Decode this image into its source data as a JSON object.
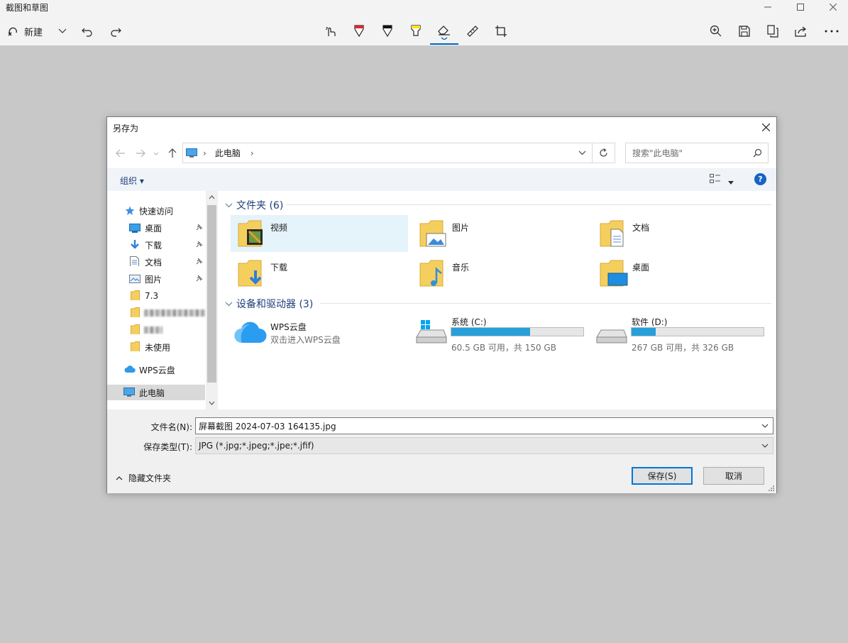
{
  "app": {
    "title": "截图和草图",
    "new_label": "新建"
  },
  "dialog": {
    "title": "另存为",
    "breadcrumb": [
      "此电脑"
    ],
    "search_placeholder": "搜索\"此电脑\"",
    "organize_label": "组织 ▾",
    "help_label": "?",
    "nav": {
      "quick_access": "快速访问",
      "items": [
        {
          "label": "桌面",
          "pinned": true
        },
        {
          "label": "下载",
          "pinned": true
        },
        {
          "label": "文档",
          "pinned": true
        },
        {
          "label": "图片",
          "pinned": true
        },
        {
          "label": "7.3",
          "pinned": false
        },
        {
          "label": "未使用",
          "pinned": false
        }
      ],
      "wps": "WPS云盘",
      "this_pc": "此电脑"
    },
    "folders_header": "文件夹 (6)",
    "folders": [
      "视频",
      "图片",
      "文档",
      "下载",
      "音乐",
      "桌面"
    ],
    "drives_header": "设备和驱动器 (3)",
    "wps_cloud": {
      "name": "WPS云盘",
      "sub": "双击进入WPS云盘"
    },
    "drives": [
      {
        "name": "系统 (C:)",
        "space": "60.5 GB 可用，共 150 GB",
        "used_fraction": 0.597
      },
      {
        "name": "软件 (D:)",
        "space": "267 GB 可用，共 326 GB",
        "used_fraction": 0.181
      }
    ],
    "filename_label": "文件名(N):",
    "filename_value": "屏幕截图 2024-07-03 164135.jpg",
    "filetype_label": "保存类型(T):",
    "filetype_value": "JPG (*.jpg;*.jpeg;*.jpe;*.jfif)",
    "hide_folders_label": "隐藏文件夹",
    "save_label": "保存(S)",
    "cancel_label": "取消"
  }
}
